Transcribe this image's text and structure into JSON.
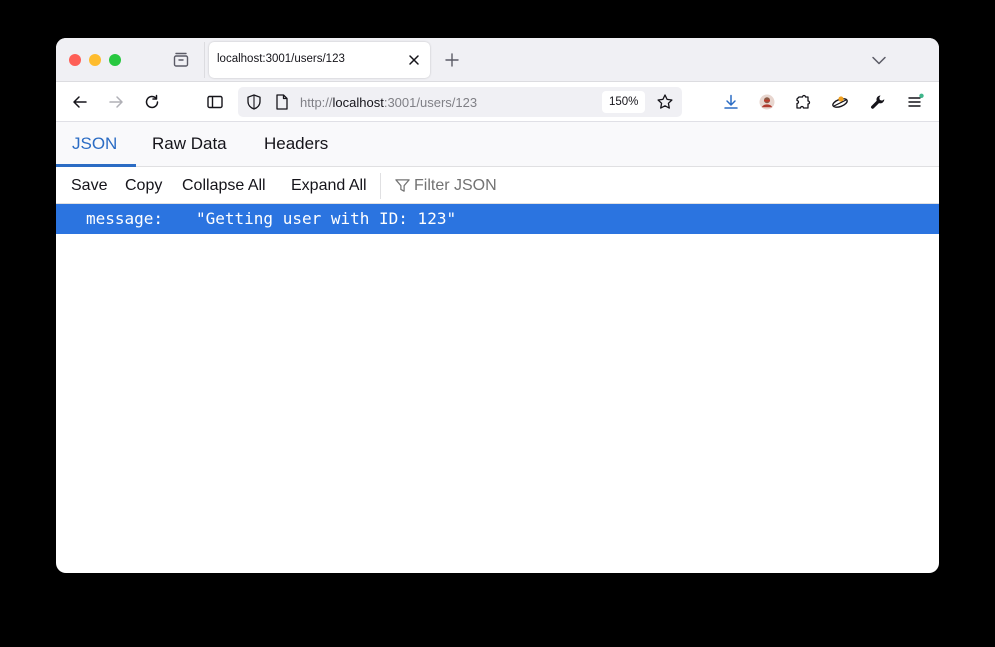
{
  "browser": {
    "tab_title": "localhost:3001/users/123",
    "url_prefix": "http://",
    "url_host": "localhost",
    "url_rest": ":3001/users/123",
    "zoom": "150%"
  },
  "viewer": {
    "tabs": [
      "JSON",
      "Raw Data",
      "Headers"
    ],
    "active_tab": "JSON",
    "toolbar": {
      "save": "Save",
      "copy": "Copy",
      "collapse_all": "Collapse All",
      "expand_all": "Expand All",
      "filter_placeholder": "Filter JSON"
    },
    "rows": [
      {
        "key": "message:",
        "value": "\"Getting user with ID: 123\""
      }
    ]
  },
  "colors": {
    "accent": "#2b6cc4",
    "selected_row": "#2b74e0"
  }
}
